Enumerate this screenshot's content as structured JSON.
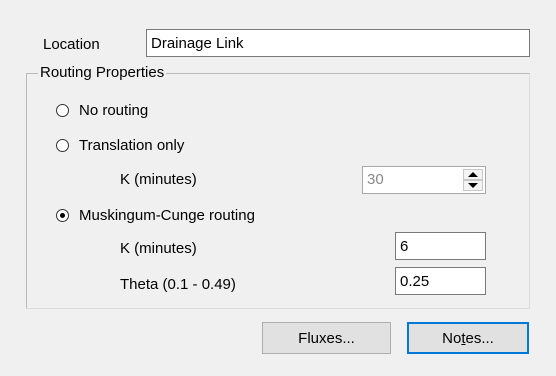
{
  "location": {
    "label": "Location",
    "value": "Drainage Link"
  },
  "routing": {
    "group_title": "Routing Properties",
    "options": [
      {
        "label": "No routing",
        "checked": false
      },
      {
        "label": "Translation only",
        "checked": false
      },
      {
        "label": "Muskingum-Cunge routing",
        "checked": true
      }
    ],
    "translation": {
      "k_label": "K (minutes)",
      "k_value": "30"
    },
    "muskingum": {
      "k_label": "K (minutes)",
      "k_value": "6",
      "theta_label": "Theta (0.1 - 0.49)",
      "theta_value": "0.25"
    }
  },
  "buttons": {
    "fluxes": "Fluxes...",
    "notes_pre": "No",
    "notes_mnemonic": "t",
    "notes_post": "es..."
  },
  "icons": {
    "spinner_up": "triangle-up-icon",
    "spinner_down": "triangle-down-icon"
  }
}
